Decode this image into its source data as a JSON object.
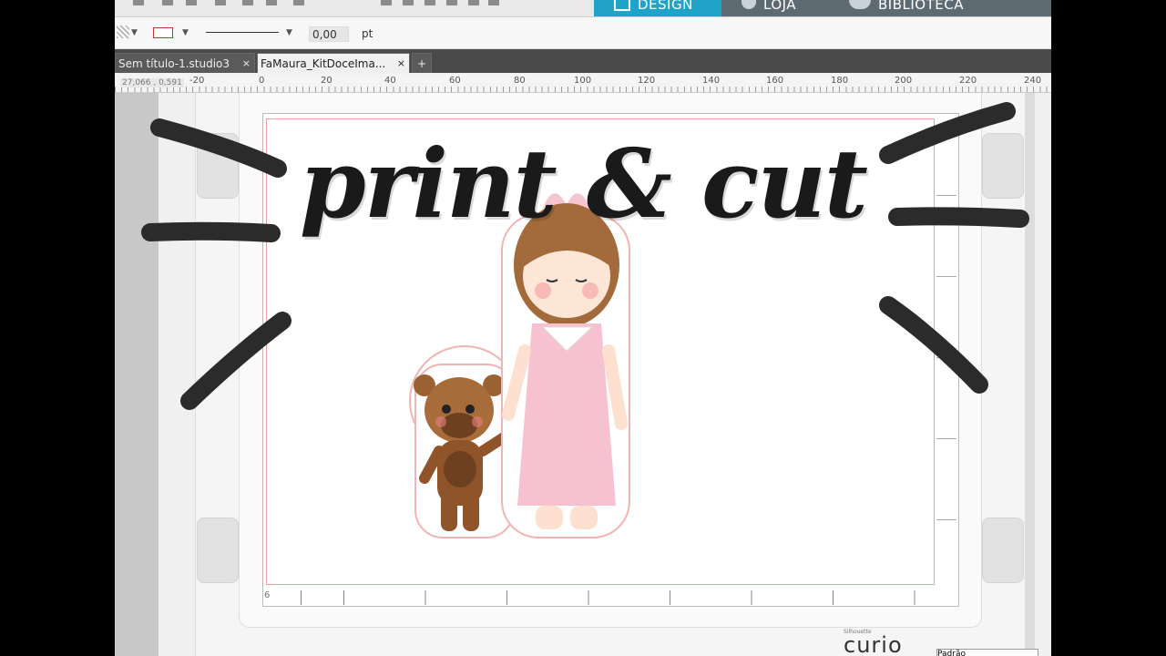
{
  "nav": {
    "tabs": [
      {
        "label": "DESIGN",
        "icon": "grid-icon",
        "color": "#1fa3c8"
      },
      {
        "label": "LOJA",
        "icon": "silhouette-s-icon",
        "color": "#5e6a72"
      },
      {
        "label": "BIBLIOTECA",
        "icon": "cloud-icon",
        "color": "#5e6a72"
      }
    ]
  },
  "line_toolbar": {
    "line_weight": "0,00",
    "unit": "pt",
    "line_color": "#c0392b"
  },
  "doc_tabs": [
    {
      "label": "Sem título-1.studio3",
      "close": "×"
    },
    {
      "label": "FaMaura_KitDoceIma...",
      "close": "×"
    }
  ],
  "add_tab": "+",
  "ruler": {
    "coordinates": "27,066 , 0,591",
    "labels": [
      "-20",
      "0",
      "20",
      "40",
      "60",
      "80",
      "100",
      "120",
      "140",
      "160",
      "180",
      "200",
      "220",
      "240"
    ]
  },
  "canvas": {
    "page_number": "6"
  },
  "brand": {
    "small": "Silhouette",
    "name": "curio"
  },
  "bottom_field": "Padrão",
  "overlay": {
    "title": "print & cut"
  }
}
